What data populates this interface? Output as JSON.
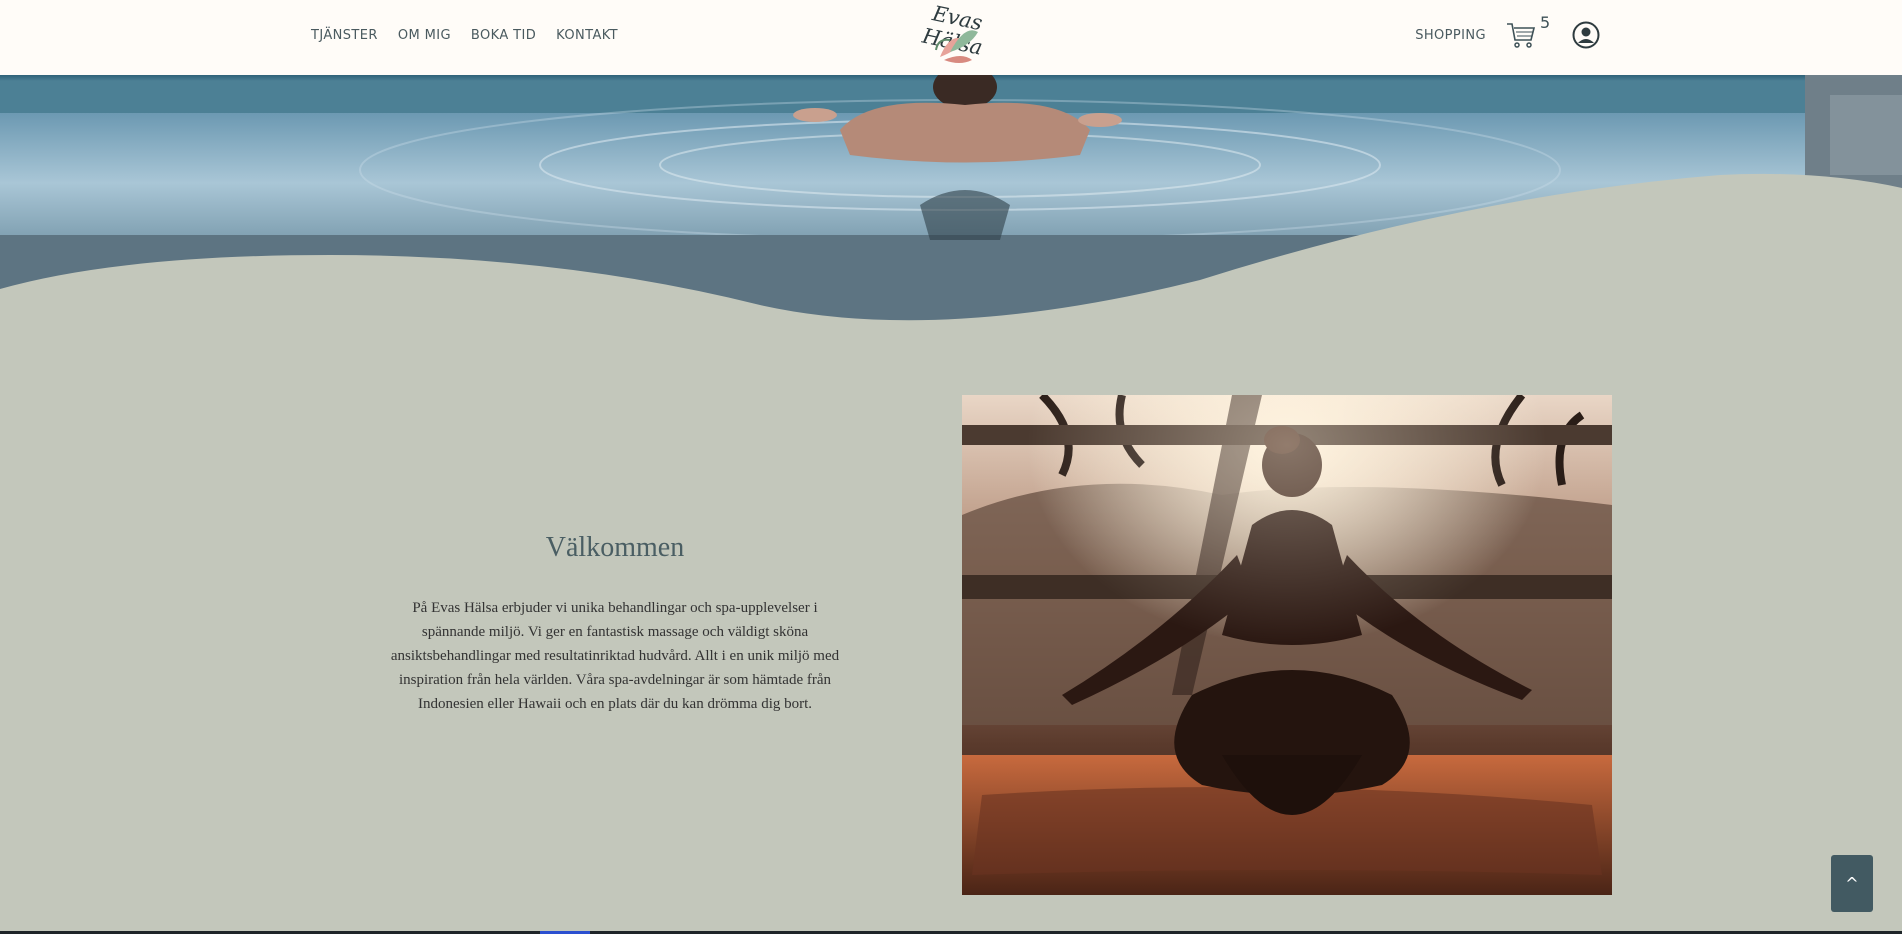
{
  "nav": {
    "left": [
      {
        "label": "TJÄNSTER"
      },
      {
        "label": "OM MIG"
      },
      {
        "label": "BOKA TID"
      },
      {
        "label": "KONTAKT"
      }
    ],
    "logo_text": "Evas Hälsa",
    "shopping_label": "SHOPPING",
    "cart_count": "5",
    "cart_icon": "shopping-cart-icon",
    "account_icon": "user-circle-icon"
  },
  "hero": {
    "image": "woman in infinity pool overlooking ocean"
  },
  "welcome": {
    "title": "Välkommen",
    "text": "På Evas Hälsa erbjuder vi unika behandlingar och spa-upplevelser i spännande miljö. Vi ger en fantastisk massage och väldigt sköna ansiktsbehandlingar med resultatinriktad hudvård. Allt i en unik miljö med inspiration från hela världen. Våra spa-avdelningar är som hämtade från Indonesien eller Hawaii och en plats där du kan drömma dig bort."
  },
  "feature_image": {
    "image": "woman meditating in lotus pose at sunset"
  },
  "back_to_top": {
    "label": "^"
  },
  "colors": {
    "header_bg": "#fffcf8",
    "page_bg": "#c3c7bb",
    "nav_text": "#4a5a5f",
    "accent": "#425a62"
  }
}
